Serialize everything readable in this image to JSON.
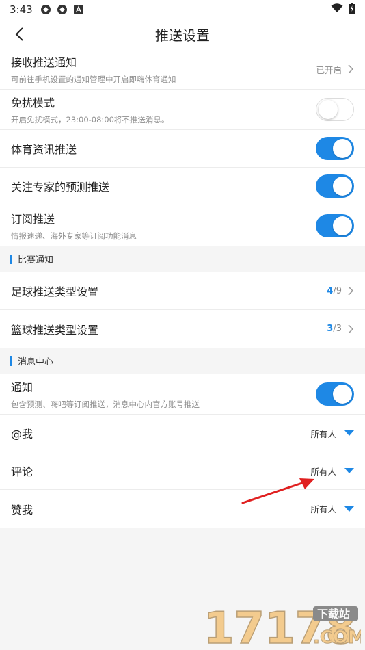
{
  "status_bar": {
    "time": "3:43"
  },
  "header": {
    "title": "推送设置"
  },
  "settings": {
    "receive": {
      "label": "接收推送通知",
      "desc": "可前往手机设置的通知管理中开启即嗨体育通知",
      "status": "已开启"
    },
    "dnd": {
      "label": "免扰模式",
      "desc": "开启免扰模式，23:00-08:00将不推送消息。",
      "on": false
    },
    "sports_news": {
      "label": "体育资讯推送",
      "on": true
    },
    "expert_predict": {
      "label": "关注专家的预测推送",
      "on": true
    },
    "subscription": {
      "label": "订阅推送",
      "desc": "情报速递、海外专家等订阅功能消息",
      "on": true
    }
  },
  "match_group": {
    "title": "比赛通知",
    "football": {
      "label": "足球推送类型设置",
      "current": "4",
      "total": "/9"
    },
    "basketball": {
      "label": "篮球推送类型设置",
      "current": "3",
      "total": "/3"
    }
  },
  "message_group": {
    "title": "消息中心",
    "notify": {
      "label": "通知",
      "desc": "包含预测、嗨吧等订阅推送，消息中心内官方账号推送",
      "on": true
    },
    "at_me": {
      "label": "@我",
      "value": "所有人"
    },
    "comment": {
      "label": "评论",
      "value": "所有人"
    },
    "like": {
      "label": "赞我",
      "value": "所有人"
    }
  },
  "watermark": {
    "text": "17178",
    "sub": "下载站",
    "domain": ".COM"
  },
  "colors": {
    "accent": "#1e88e5",
    "arrow": "#e02020"
  }
}
